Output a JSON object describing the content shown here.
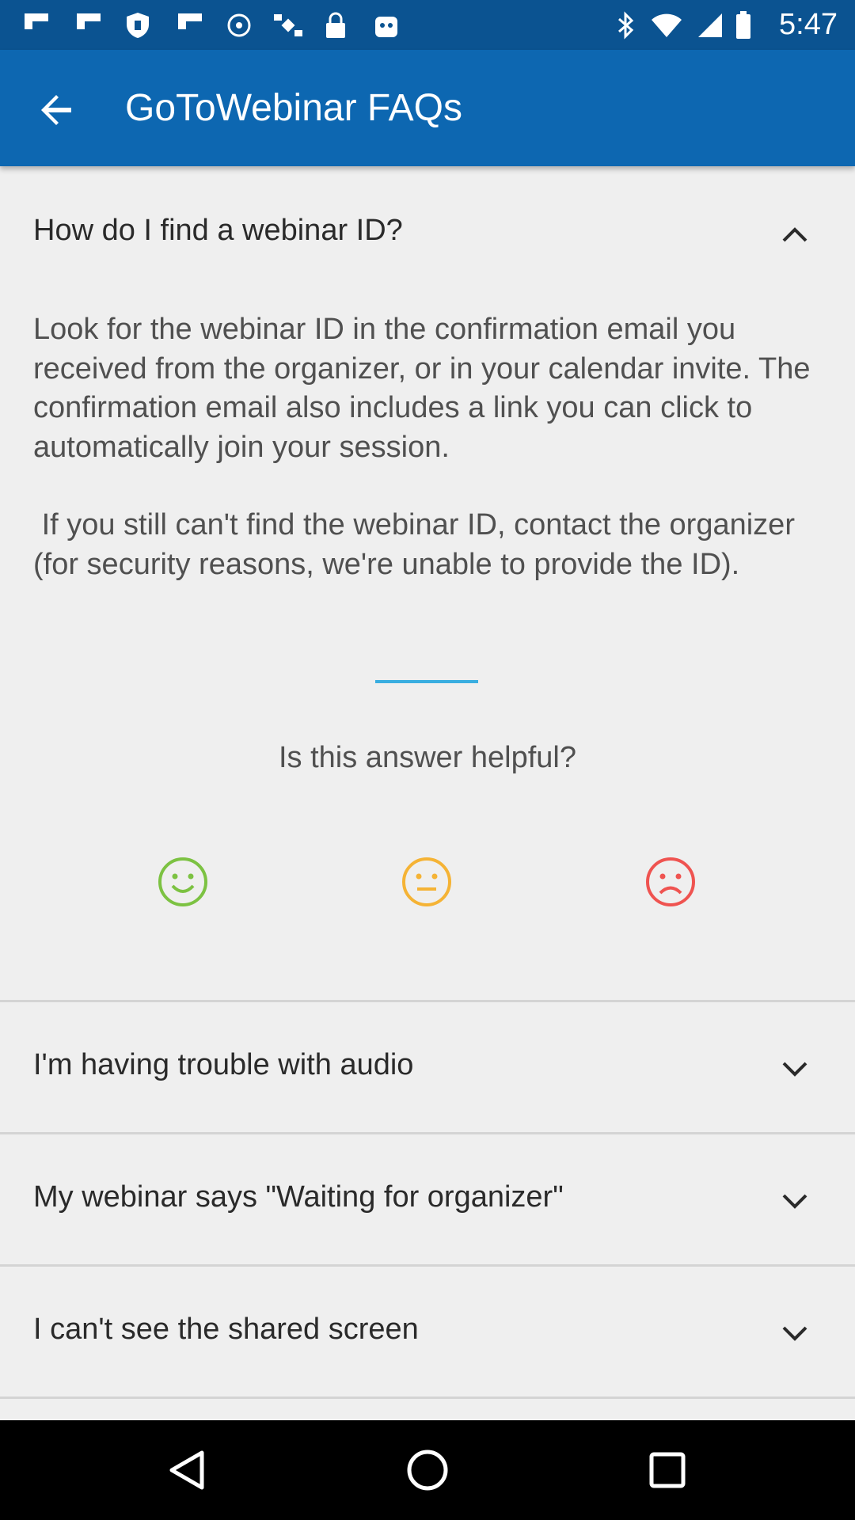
{
  "status_bar": {
    "time": "5:47",
    "left_icons": [
      "flipboard-icon",
      "flipboard-icon",
      "shield-icon",
      "flipboard-icon",
      "signal-icon",
      "satellite-icon",
      "lock-icon",
      "app-icon"
    ],
    "right_icons": [
      "bluetooth-icon",
      "wifi-icon",
      "cell-signal-icon",
      "battery-icon"
    ]
  },
  "app_bar": {
    "title": "GoToWebinar FAQs",
    "back_icon": "arrow-back-icon"
  },
  "faq_expanded": {
    "question": "How do I find a webinar ID?",
    "answer_paragraphs": [
      "Look for the webinar ID in the confirmation email you received from the organizer, or in your calendar invite. The confirmation email also includes a link you can click to automatically join your session.",
      " If you still can't find the webinar ID, contact the organizer (for security reasons, we're unable to provide the ID)."
    ],
    "helpful_prompt": "Is this answer helpful?",
    "feedback": [
      {
        "icon": "happy-face-icon",
        "color": "#7cc242"
      },
      {
        "icon": "neutral-face-icon",
        "color": "#f5b335"
      },
      {
        "icon": "sad-face-icon",
        "color": "#ef5350"
      }
    ]
  },
  "faq_collapsed": [
    {
      "question": "I'm having trouble with audio"
    },
    {
      "question": "My webinar says \"Waiting for organizer\""
    },
    {
      "question": "I can't see the shared screen"
    }
  ],
  "colors": {
    "status_bar": "#0b5391",
    "app_bar": "#0d67b1",
    "accent": "#3aaee0",
    "background": "#efefef"
  },
  "nav_bar": {
    "icons": [
      "back-triangle-icon",
      "home-circle-icon",
      "recents-square-icon"
    ]
  }
}
